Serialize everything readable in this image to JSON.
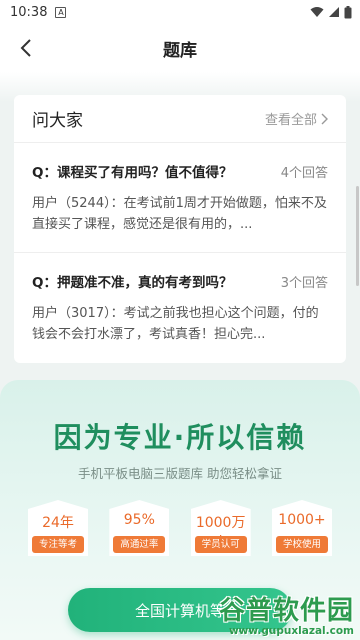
{
  "status_bar": {
    "time": "10:38",
    "notification_letter": "A",
    "icons": [
      "wifi-icon",
      "signal-icon",
      "battery-icon"
    ]
  },
  "header": {
    "title": "题库",
    "back_icon": "chevron-left-icon"
  },
  "card": {
    "title": "问大家",
    "more_label": "查看全部",
    "questions": [
      {
        "question": "Q：课程买了有用吗？值不值得？",
        "answer_count": "4个回答",
        "answer_preview": "用户（5244）：在考试前1周才开始做题，怕来不及直接买了课程，感觉还是很有用的，..."
      },
      {
        "question": "Q：押题准不准，真的有考到吗？",
        "answer_count": "3个回答",
        "answer_preview": "用户（3017）：考试之前我也担心这个问题，付的钱会不会打水漂了，考试真香！担心完..."
      }
    ]
  },
  "promo": {
    "slogan": "因为专业·所以信赖",
    "subtitle": "手机平板电脑三版题库 助您轻松拿证",
    "badges": [
      {
        "value": "24年",
        "label": "专注等考"
      },
      {
        "value": "95%",
        "label": "高通过率"
      },
      {
        "value": "1000万+",
        "label": "学员认可"
      },
      {
        "value": "1000+",
        "label": "学校使用"
      }
    ],
    "cta_label": "全国计算机等"
  },
  "watermark": {
    "main": "谷普软件园",
    "url": "www.gupuxlazal.com"
  },
  "colors": {
    "accent_green": "#1f8e5e",
    "badge_orange": "#ef7a37",
    "cta_green": "#21b27a"
  }
}
